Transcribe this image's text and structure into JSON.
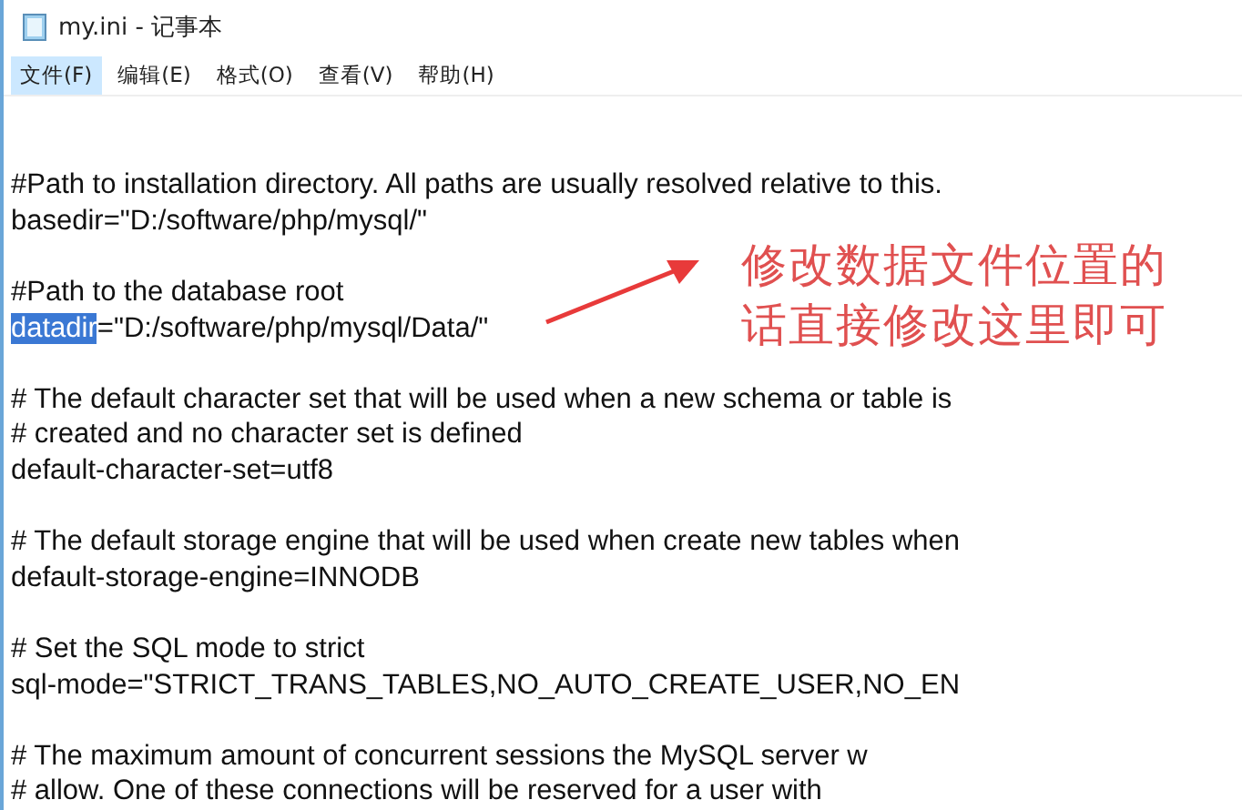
{
  "window": {
    "title": "my.ini - 记事本"
  },
  "menu": [
    {
      "label": "文件(F)",
      "selected": true
    },
    {
      "label": "编辑(E)",
      "selected": false
    },
    {
      "label": "格式(O)",
      "selected": false
    },
    {
      "label": "查看(V)",
      "selected": false
    },
    {
      "label": "帮助(H)",
      "selected": false
    }
  ],
  "lines": [
    {
      "kind": "blank"
    },
    {
      "kind": "blank"
    },
    {
      "kind": "text",
      "text": "#Path to installation directory. All paths are usually resolved relative to this."
    },
    {
      "kind": "text",
      "text": "basedir=\"D:/software/php/mysql/\""
    },
    {
      "kind": "blank"
    },
    {
      "kind": "text",
      "text": "#Path to the database root"
    },
    {
      "kind": "text",
      "selection": "datadir",
      "text": "=\"D:/software/php/mysql/Data/\""
    },
    {
      "kind": "blank"
    },
    {
      "kind": "text",
      "text": "# The default character set that will be used when a new schema or table is"
    },
    {
      "kind": "text",
      "text": "# created and no character set is defined"
    },
    {
      "kind": "text",
      "text": "default-character-set=utf8"
    },
    {
      "kind": "blank"
    },
    {
      "kind": "text",
      "text": "# The default storage engine that will be used when create new tables when"
    },
    {
      "kind": "text",
      "text": "default-storage-engine=INNODB"
    },
    {
      "kind": "blank"
    },
    {
      "kind": "text",
      "text": "# Set the SQL mode to strict"
    },
    {
      "kind": "text",
      "text": "sql-mode=\"STRICT_TRANS_TABLES,NO_AUTO_CREATE_USER,NO_EN"
    },
    {
      "kind": "blank"
    },
    {
      "kind": "text",
      "text": "# The maximum amount of concurrent sessions the MySQL server w"
    },
    {
      "kind": "text",
      "text": "# allow. One of these connections will be reserved for a user with"
    }
  ],
  "annotation": {
    "lines": [
      "修改数据文件位置的",
      "话直接修改这里即可"
    ]
  }
}
